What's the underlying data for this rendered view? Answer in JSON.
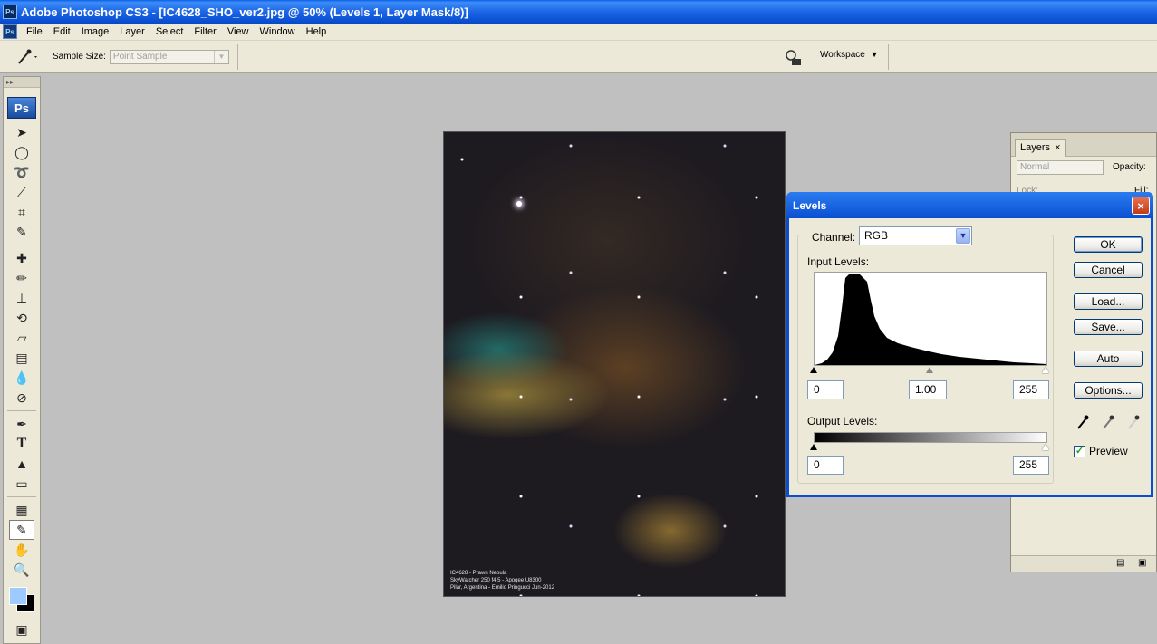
{
  "window": {
    "title": "Adobe Photoshop CS3 - [IC4628_SHO_ver2.jpg @ 50% (Levels 1, Layer Mask/8)]"
  },
  "menu": {
    "items": [
      "File",
      "Edit",
      "Image",
      "Layer",
      "Select",
      "Filter",
      "View",
      "Window",
      "Help"
    ]
  },
  "options": {
    "sample_size_label": "Sample Size:",
    "sample_size_value": "Point Sample",
    "workspace_label": "Workspace"
  },
  "toolbox": {
    "badge": "Ps"
  },
  "image": {
    "caption_line1": "IC4628 - Prawn Nebula",
    "caption_line2": "SkyWatcher 250 f4.5 - Apogee U8300",
    "caption_line3": "Pilar, Argentina - Emilio Pringucci Jun-2012"
  },
  "layers": {
    "tab_label": "Layers",
    "tab_close": "×",
    "blend_mode": "Normal",
    "opacity_label": "Opacity:",
    "lock_label": "Lock:",
    "fill_label": "Fill:"
  },
  "levels": {
    "title": "Levels",
    "close": "×",
    "channel_label": "Channel:",
    "channel_value": "RGB",
    "input_label": "Input Levels:",
    "input_black": "0",
    "input_gamma": "1.00",
    "input_white": "255",
    "output_label": "Output Levels:",
    "output_black": "0",
    "output_white": "255",
    "buttons": {
      "ok": "OK",
      "cancel": "Cancel",
      "load": "Load...",
      "save": "Save...",
      "auto": "Auto",
      "options": "Options..."
    },
    "preview_label": "Preview",
    "preview_checked": true
  }
}
